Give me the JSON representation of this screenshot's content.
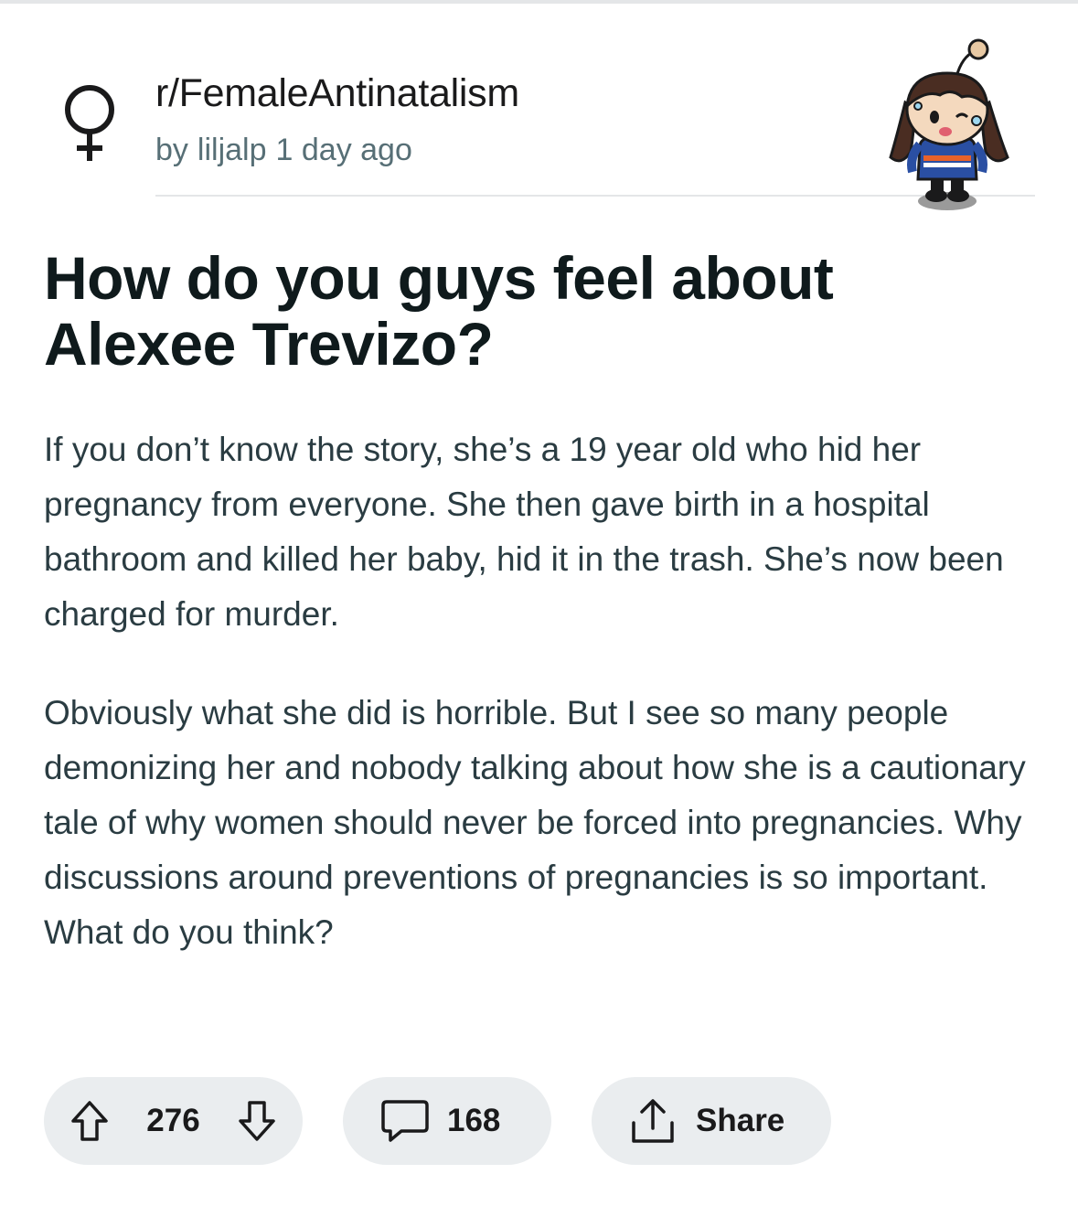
{
  "post": {
    "subreddit": "r/FemaleAntinatalism",
    "by": "by",
    "author": "liljalp",
    "age": "1 day ago",
    "title": "How do you guys feel about Alexee Trevizo?",
    "body": [
      "If you don’t know the story, she’s a 19 year old who hid her pregnancy from everyone. She then gave birth in a hospital bathroom and killed her baby, hid it in the trash. She’s now been charged for murder.",
      "Obviously what she did is horrible. But I see so many people demonizing her and nobody talking about how she is a cautionary tale of why women should never be forced into pregnancies. Why discussions around preventions of pregnancies is so important. What do you think?"
    ]
  },
  "actions": {
    "votes": "276",
    "comments": "168",
    "share_label": "Share"
  },
  "icons": {
    "subreddit": "female-symbol-icon",
    "upvote": "arrow-up-icon",
    "downvote": "arrow-down-icon",
    "comment": "speech-bubble-icon",
    "share": "share-upload-icon"
  },
  "colors": {
    "text": "#1a1a1b",
    "meta": "#576f76",
    "pill_bg": "#eaedef"
  }
}
